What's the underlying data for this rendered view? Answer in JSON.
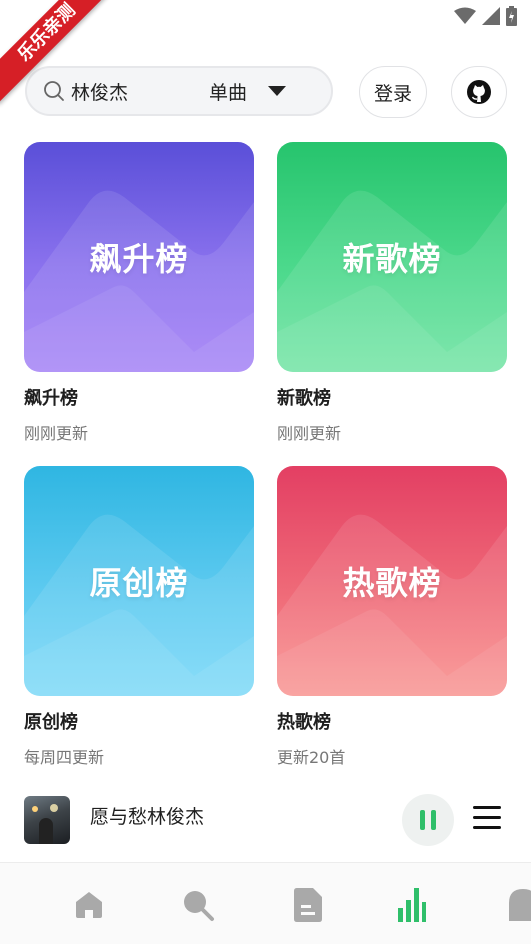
{
  "ribbon": {
    "text": "乐乐亲测"
  },
  "header": {
    "search_value": "林俊杰",
    "search_type": "单曲",
    "login_label": "登录"
  },
  "charts": [
    {
      "cover_text": "飙升榜",
      "title": "飙升榜",
      "subtitle": "刚刚更新"
    },
    {
      "cover_text": "新歌榜",
      "title": "新歌榜",
      "subtitle": "刚刚更新"
    },
    {
      "cover_text": "原创榜",
      "title": "原创榜",
      "subtitle": "每周四更新"
    },
    {
      "cover_text": "热歌榜",
      "title": "热歌榜",
      "subtitle": "更新20首"
    }
  ],
  "player": {
    "song_title": "愿与愁林俊杰"
  },
  "nav": {
    "items": [
      {
        "icon": "home-icon",
        "active": false
      },
      {
        "icon": "search-icon",
        "active": false
      },
      {
        "icon": "playlist-icon",
        "active": false
      },
      {
        "icon": "chart-icon",
        "active": true
      },
      {
        "icon": "profile-icon",
        "active": false
      }
    ]
  },
  "colors": {
    "accent": "#2fbf6a",
    "nav_inactive": "#a9a9a9",
    "card1": "#6c5ce7",
    "card2": "#2ecc71",
    "card3": "#3fbde8",
    "card4": "#ea5068"
  }
}
